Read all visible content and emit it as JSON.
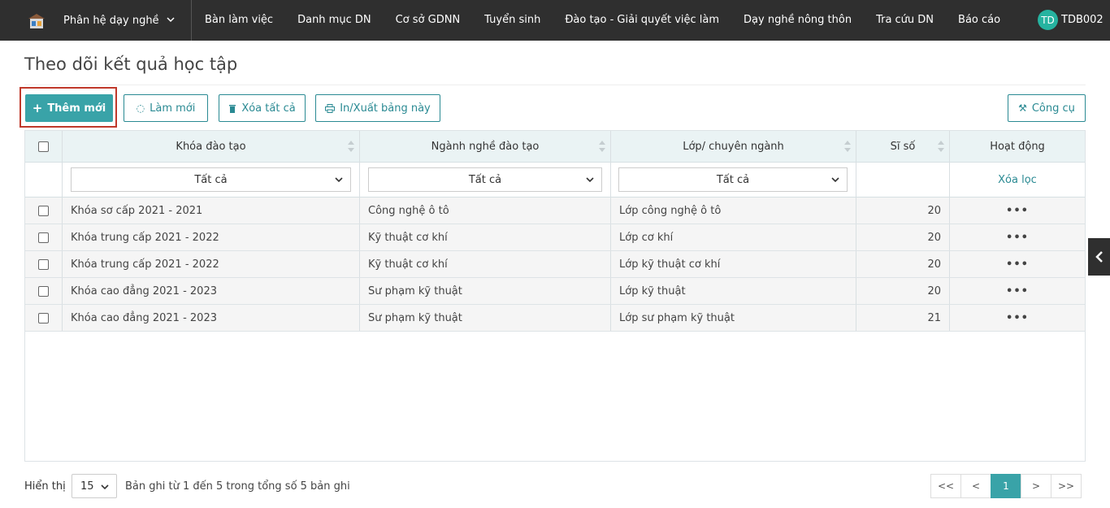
{
  "topbar": {
    "module": "Phân hệ dạy nghề",
    "nav": [
      "Bàn làm việc",
      "Danh mục DN",
      "Cơ sở GDNN",
      "Tuyển sinh",
      "Đào tạo - Giải quyết việc làm",
      "Dạy nghề nông thôn",
      "Tra cứu DN",
      "Báo cáo"
    ],
    "avatar_initials": "TD",
    "username": "TDB002"
  },
  "page": {
    "title": "Theo dõi kết quả học tập"
  },
  "toolbar": {
    "add_label": "Thêm mới",
    "refresh_label": "Làm mới",
    "delete_all_label": "Xóa tất cả",
    "export_label": "In/Xuất bảng này",
    "tools_label": "Công cụ"
  },
  "table": {
    "headers": {
      "course": "Khóa đào tạo",
      "major": "Ngành nghề đào tạo",
      "class": "Lớp/ chuyên ngành",
      "count": "Sĩ số",
      "actions": "Hoạt động"
    },
    "filters": {
      "course": "Tất cả",
      "major": "Tất cả",
      "class": "Tất cả",
      "clear": "Xóa lọc"
    },
    "rows": [
      {
        "course": "Khóa sơ cấp 2021 - 2021",
        "major": "Công nghệ ô tô",
        "class": "Lớp công nghệ ô tô",
        "count": "20",
        "actions": "•••"
      },
      {
        "course": "Khóa trung cấp 2021 - 2022",
        "major": "Kỹ thuật cơ khí",
        "class": "Lớp cơ khí",
        "count": "20",
        "actions": "•••"
      },
      {
        "course": "Khóa trung cấp 2021 - 2022",
        "major": "Kỹ thuật cơ khí",
        "class": "Lớp kỹ thuật cơ khí",
        "count": "20",
        "actions": "•••"
      },
      {
        "course": "Khóa cao đẳng 2021 - 2023",
        "major": "Sư phạm kỹ thuật",
        "class": "Lớp kỹ thuật",
        "count": "20",
        "actions": "•••"
      },
      {
        "course": "Khóa cao đẳng 2021 - 2023",
        "major": "Sư phạm kỹ thuật",
        "class": "Lớp sư phạm kỹ thuật",
        "count": "21",
        "actions": "•••"
      }
    ]
  },
  "footer": {
    "show_label": "Hiển thị",
    "page_size": "15",
    "info": "Bản ghi từ 1 đến 5 trong tổng số 5 bản ghi",
    "pager": {
      "first": "<<",
      "prev": "<",
      "current": "1",
      "next": ">",
      "last": ">>"
    }
  }
}
